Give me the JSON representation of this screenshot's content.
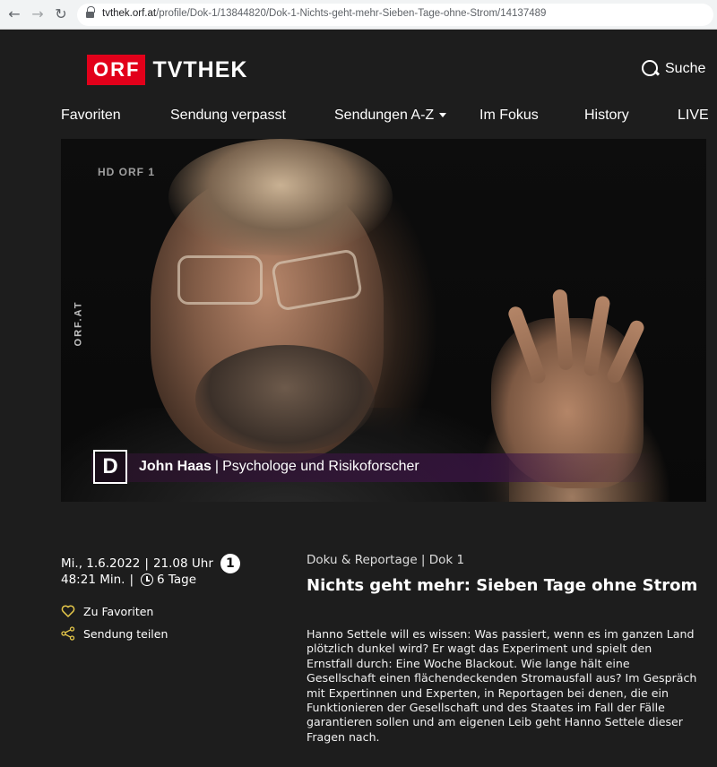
{
  "browser": {
    "url_host": "tvthek.orf.at",
    "url_path": "/profile/Dok-1/13844820/Dok-1-Nichts-geht-mehr-Sieben-Tage-ohne-Strom/14137489"
  },
  "header": {
    "logo_orf": "ORF",
    "logo_tvthek": "TVTHEK",
    "search_label": "Suche"
  },
  "nav": {
    "items": [
      "Favoriten",
      "Sendung verpasst",
      "Sendungen A-Z",
      "Im Fokus",
      "History",
      "LIVE"
    ]
  },
  "video": {
    "watermark": "HD ORF 1",
    "side_label": "ORF.AT",
    "show_logo": "D",
    "caption_name": "John Haas",
    "caption_separator": "|",
    "caption_role": "Psychologe und Risikoforscher"
  },
  "meta": {
    "date": "Mi., 1.6.2022",
    "time": "21.08 Uhr",
    "channel": "1",
    "duration": "48:21 Min.",
    "availability": "6 Tage"
  },
  "actions": {
    "favorite": "Zu Favoriten",
    "share": "Sendung teilen"
  },
  "episode": {
    "genre": "Doku & Reportage | Dok 1",
    "title": "Nichts geht mehr: Sieben Tage ohne Strom",
    "description": "Hanno Settele will es wissen: Was passiert, wenn es im ganzen Land plötzlich dunkel wird? Er wagt das Experiment und spielt den Ernstfall durch: Eine Woche Blackout. Wie lange hält eine Gesellschaft einen flächendeckenden Stromausfall aus? Im Gespräch mit Expertinnen und Experten, in Reportagen bei denen, die ein Funktionieren der Gesellschaft und des Staates im Fall der Fälle garantieren sollen und am eigenen Leib geht Hanno Settele dieser Fragen nach."
  },
  "colors": {
    "brand_red": "#e2001a",
    "background": "#1d1d1d",
    "accent_yellow": "#e6c84a"
  }
}
